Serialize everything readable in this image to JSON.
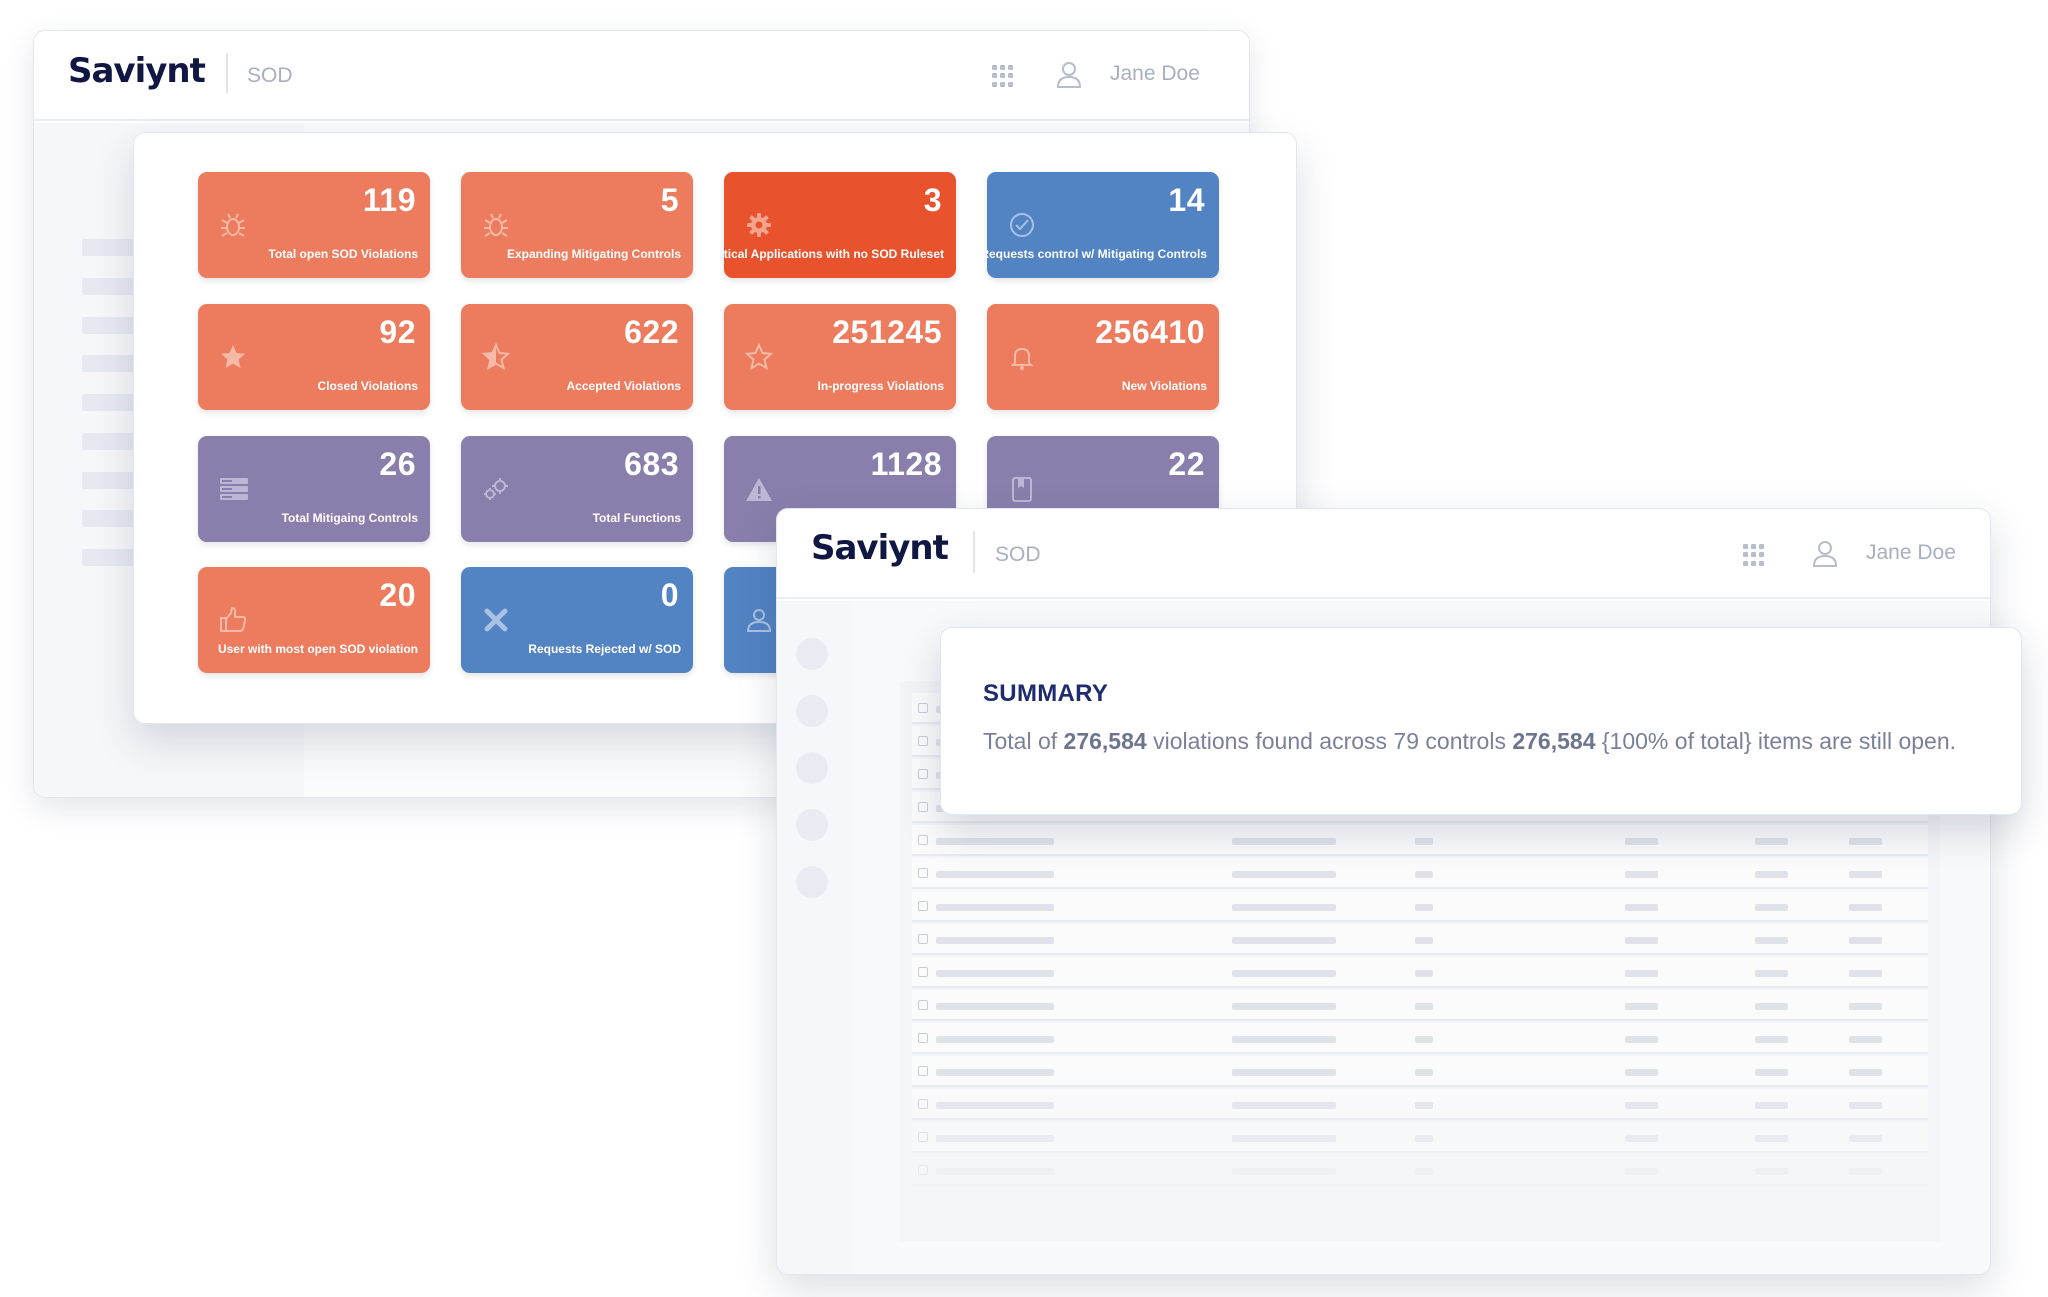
{
  "window_main": {
    "logo": "Saviynt",
    "module": "SOD",
    "user_name": "Jane Doe"
  },
  "tiles": [
    {
      "value": "119",
      "label": "Total open SOD Violations",
      "icon": "bug-icon",
      "color": "#ed7b5e"
    },
    {
      "value": "5",
      "label": "Expanding Mitigating Controls",
      "icon": "bug-icon",
      "color": "#ed7b5e"
    },
    {
      "value": "3",
      "label": "Critical Applications with no SOD Ruleset",
      "icon": "gear-icon",
      "color": "#e8532e"
    },
    {
      "value": "14",
      "label": "Requests control w/ Mitigating Controls",
      "icon": "check-circle-icon",
      "color": "#5283c3"
    },
    {
      "value": "92",
      "label": "Closed Violations",
      "icon": "star-icon",
      "color": "#ed7b5e"
    },
    {
      "value": "622",
      "label": "Accepted Violations",
      "icon": "star-half-icon",
      "color": "#ed7b5e"
    },
    {
      "value": "251245",
      "label": "In-progress Violations",
      "icon": "star-outline-icon",
      "color": "#ed7b5e"
    },
    {
      "value": "256410",
      "label": "New Violations",
      "icon": "bell-icon",
      "color": "#ed7b5e"
    },
    {
      "value": "26",
      "label": "Total Mitigaing Controls",
      "icon": "server-icon",
      "color": "#8a7fac"
    },
    {
      "value": "683",
      "label": "Total Functions",
      "icon": "gears-icon",
      "color": "#8a7fac"
    },
    {
      "value": "1128",
      "label": "",
      "icon": "warning-icon",
      "color": "#8a7fac"
    },
    {
      "value": "22",
      "label": "",
      "icon": "book-icon",
      "color": "#8a7fac"
    },
    {
      "value": "20",
      "label": "User with most  open SOD violation",
      "icon": "thumbs-up-icon",
      "color": "#ed7b5e"
    },
    {
      "value": "0",
      "label": "Requests Rejected w/ SOD",
      "icon": "close-x-icon",
      "color": "#5283c3"
    },
    {
      "value": "",
      "label": "",
      "icon": "user-icon",
      "color": "#5283c3"
    }
  ],
  "window_detail": {
    "logo": "Saviynt",
    "module": "SOD",
    "user_name": "Jane Doe"
  },
  "summary": {
    "title": "SUMMARY",
    "text_prefix": "Total of ",
    "total_violations": "276,584",
    "text_mid": " violations found across 79 controls ",
    "open_items": "276,584",
    "text_suffix": " {100% of total} items are still open."
  }
}
